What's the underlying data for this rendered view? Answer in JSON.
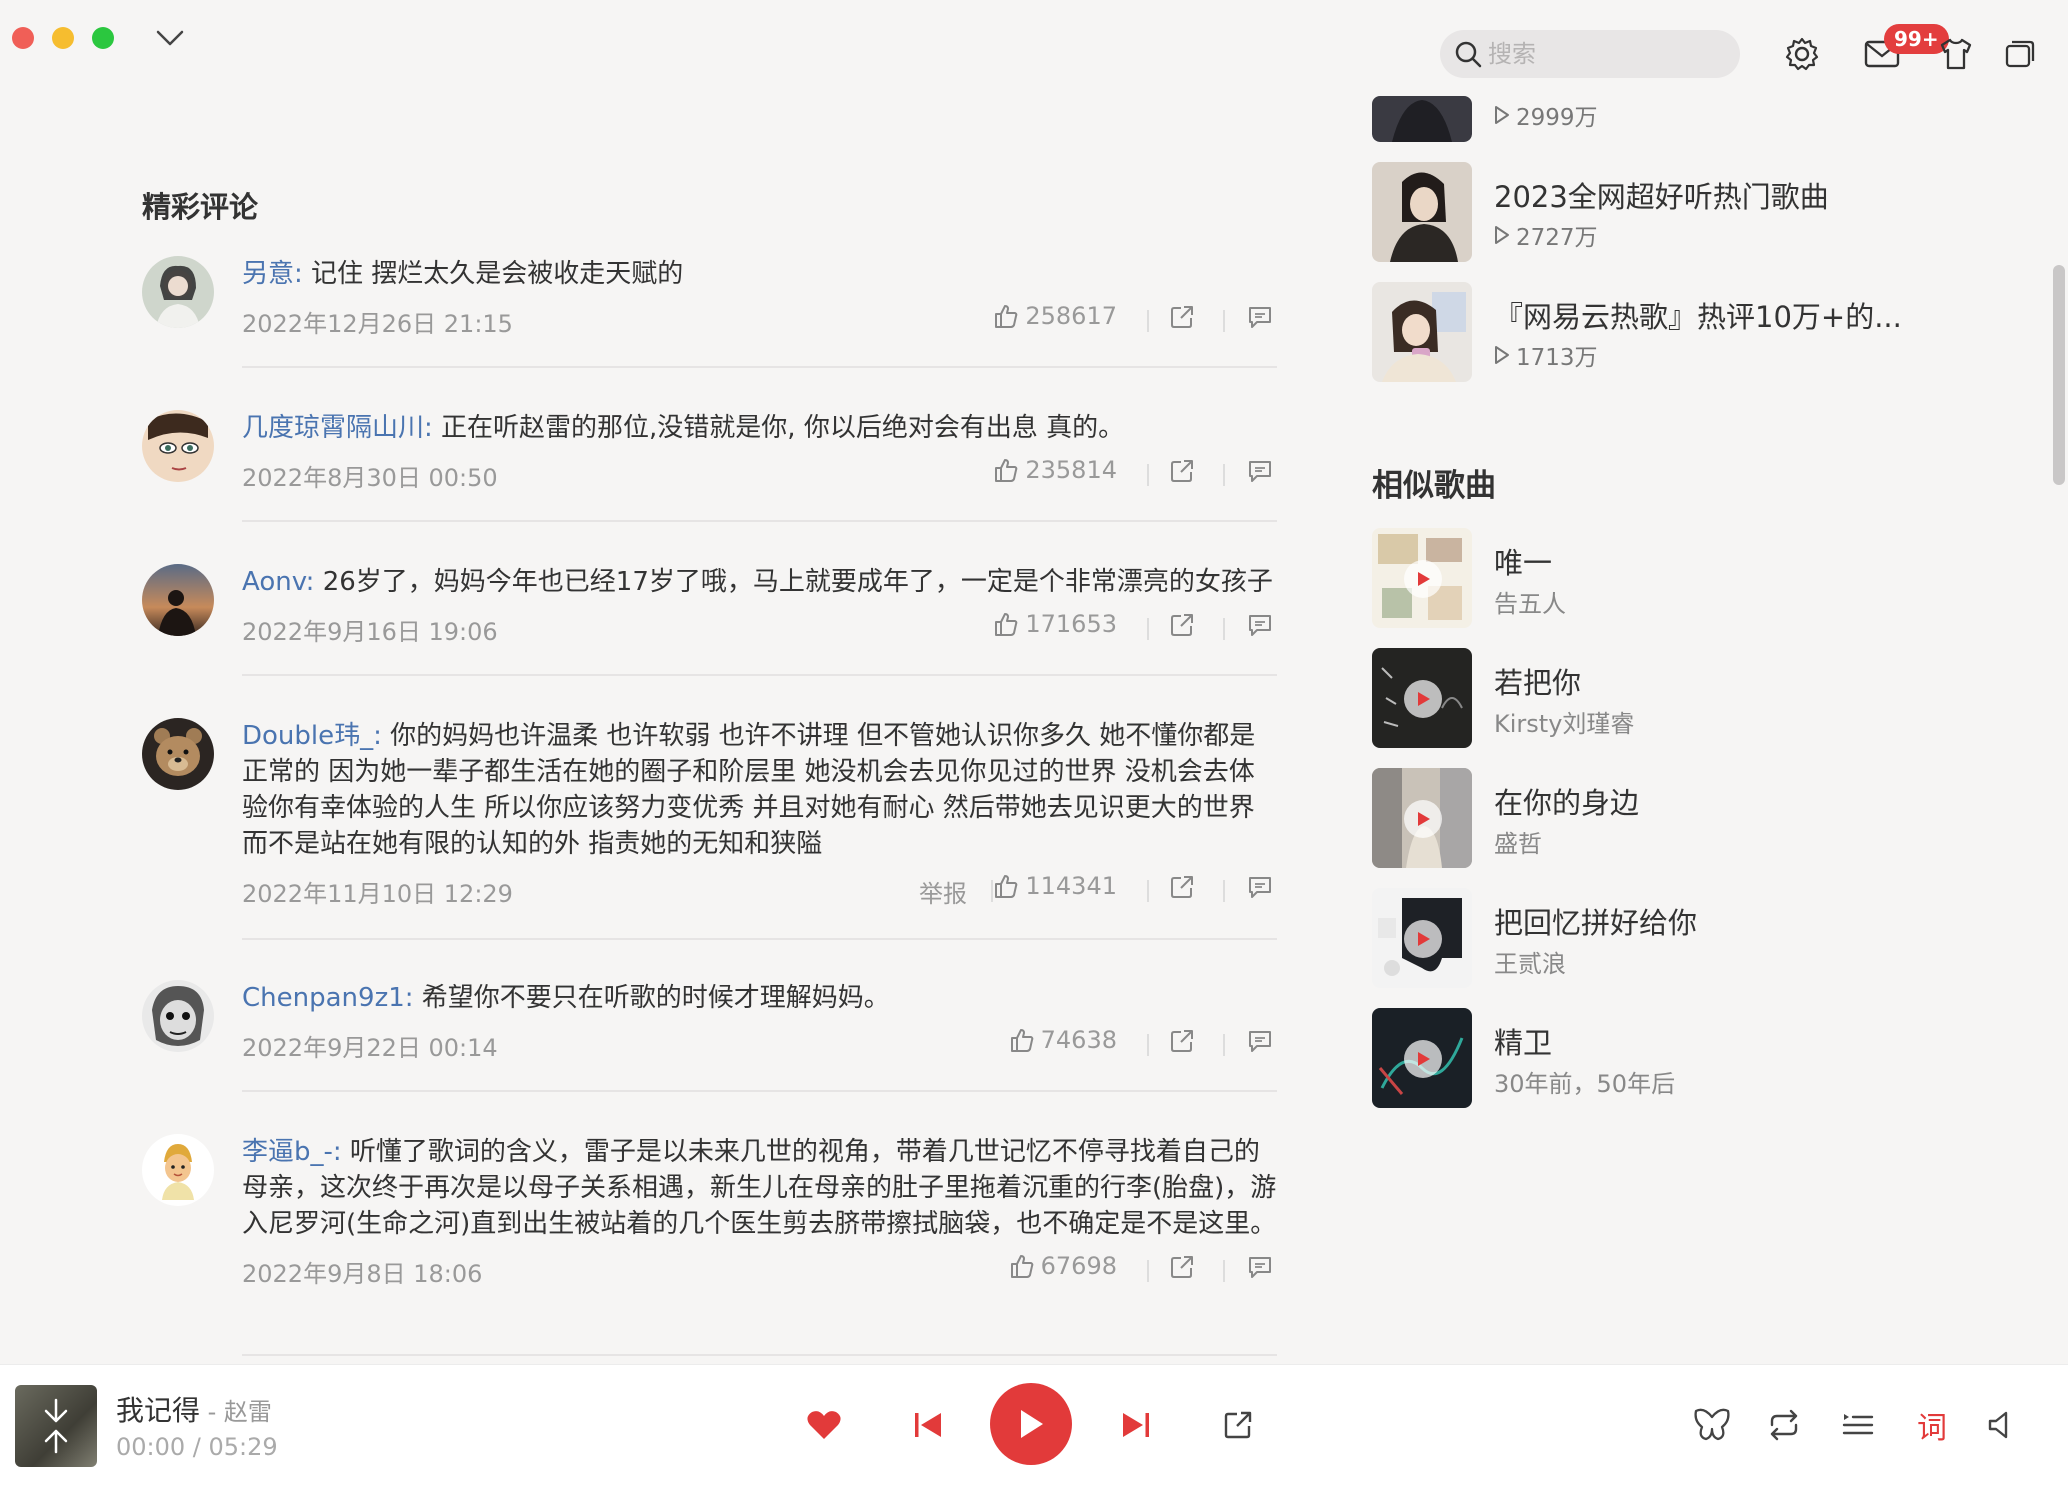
{
  "search": {
    "placeholder": "搜索"
  },
  "top": {
    "badge": "99+"
  },
  "comments_section": {
    "title": "精彩评论",
    "report_label": "举报"
  },
  "comments": [
    {
      "user": "另意:",
      "text": " 记住 摆烂太久是会被收走天赋的",
      "time": "2022年12月26日 21:15",
      "likes": "258617"
    },
    {
      "user": "几度琼霄隔山川:",
      "text": " 正在听赵雷的那位,没错就是你, 你以后绝对会有出息 真的。",
      "time": "2022年8月30日 00:50",
      "likes": "235814"
    },
    {
      "user": "Aonv:",
      "text": " 26岁了，妈妈今年也已经17岁了哦，马上就要成年了，一定是个非常漂亮的女孩子",
      "time": "2022年9月16日 19:06",
      "likes": "171653"
    },
    {
      "user": "Double玮_:",
      "text": " 你的妈妈也许温柔 也许软弱 也许不讲理 但不管她认识你多久 她不懂你都是正常的 因为她一辈子都生活在她的圈子和阶层里 她没机会去见你见过的世界 没机会去体验你有幸体验的人生 所以你应该努力变优秀 并且对她有耐心 然后带她去见识更大的世界 而不是站在她有限的认知的外 指责她的无知和狭隘",
      "time": "2022年11月10日 12:29",
      "likes": "114341"
    },
    {
      "user": "Chenpan9z1:",
      "text": " 希望你不要只在听歌的时候才理解妈妈。",
      "time": "2022年9月22日 00:14",
      "likes": "74638"
    },
    {
      "user": "李逼b_-:",
      "text": " 听懂了歌词的含义，雷子是以未来几世的视角，带着几世记忆不停寻找着自己的母亲，这次终于再次是以母子关系相遇，新生儿在母亲的肚子里拖着沉重的行李(胎盘)，游入尼罗河(生命之河)直到出生被站着的几个医生剪去脐带擦拭脑袋，也不确定是不是这里。",
      "time": "2022年9月8日 18:06",
      "likes": "67698"
    }
  ],
  "playlists": [
    {
      "title": "",
      "plays": "2999万"
    },
    {
      "title": "2023全网超好听热门歌曲",
      "plays": "2727万"
    },
    {
      "title": "『网易云热歌』热评10万+的...",
      "plays": "1713万"
    }
  ],
  "similar": {
    "title": "相似歌曲",
    "songs": [
      {
        "name": "唯一",
        "artist": "告五人"
      },
      {
        "name": "若把你",
        "artist": "Kirsty刘瑾睿"
      },
      {
        "name": "在你的身边",
        "artist": "盛哲"
      },
      {
        "name": "把回忆拼好给你",
        "artist": "王贰浪"
      },
      {
        "name": "精卫",
        "artist": "30年前，50年后"
      }
    ]
  },
  "player": {
    "title": "我记得",
    "artist": " - 赵雷",
    "time": "00:00 /  05:29",
    "lyrics_label": "词"
  },
  "colors": {
    "accent": "#e23a3a",
    "username": "#4a74b0"
  }
}
